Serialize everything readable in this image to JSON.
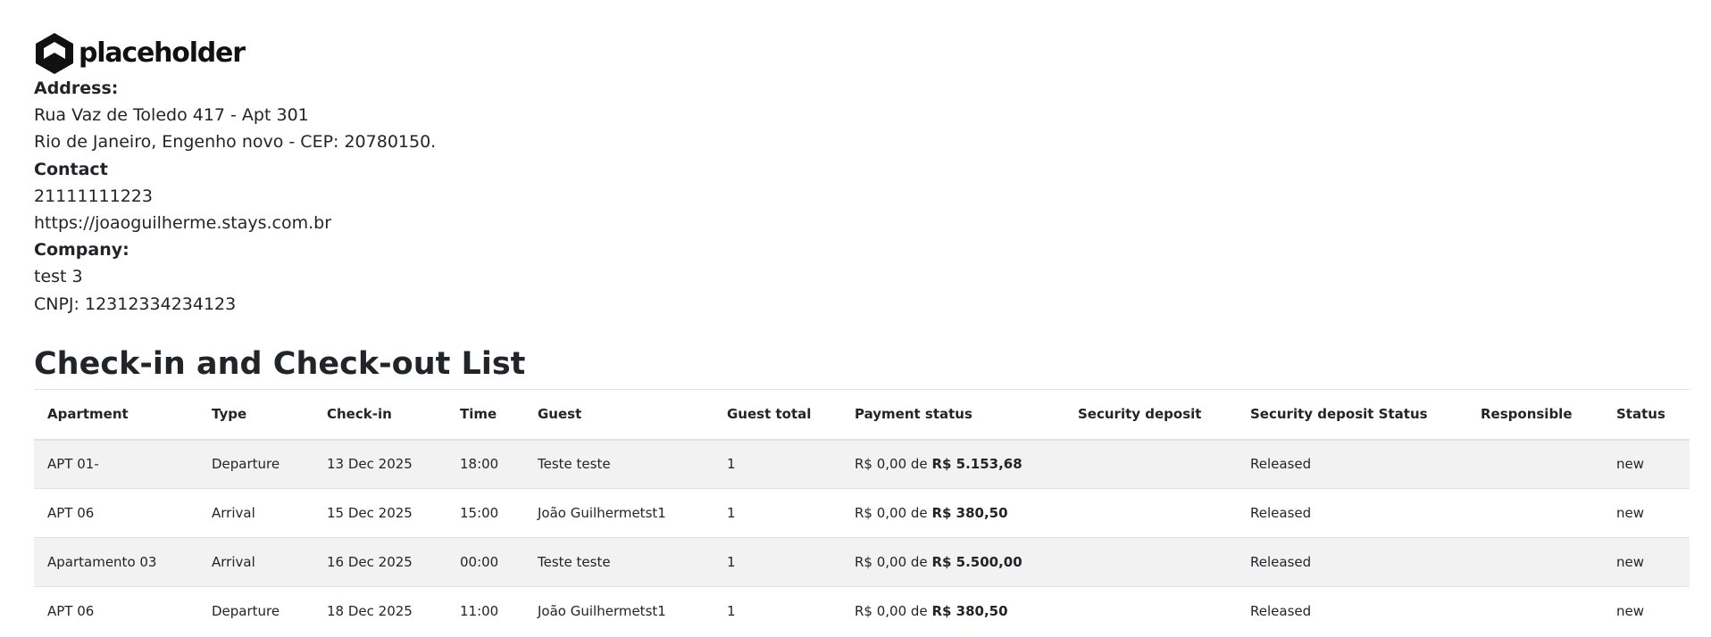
{
  "logo": {
    "text": "placeholder"
  },
  "info": {
    "address_label": "Address:",
    "address_line1": "Rua Vaz de Toledo 417 - Apt 301",
    "address_line2": "Rio de Janeiro, Engenho novo - CEP: 20780150.",
    "contact_label": "Contact",
    "phone": "21111111223",
    "website": "https://joaoguilherme.stays.com.br",
    "company_label": "Company:",
    "company_name": "test 3",
    "cnpj": "CNPJ: 12312334234123"
  },
  "title": "Check-in and Check-out List",
  "table": {
    "headers": {
      "apartment": "Apartment",
      "type": "Type",
      "checkin": "Check-in",
      "time": "Time",
      "guest": "Guest",
      "guest_total": "Guest total",
      "payment_status": "Payment status",
      "security_deposit": "Security deposit",
      "security_deposit_status": "Security deposit Status",
      "responsible": "Responsible",
      "status": "Status"
    },
    "rows": [
      {
        "apartment": "APT 01-",
        "type": "Departure",
        "checkin": "13 Dec 2025",
        "time": "18:00",
        "guest": "Teste teste",
        "guest_total": "1",
        "paid": "R$ 0,00 de",
        "total": "R$ 5.153,68",
        "security_deposit": "",
        "security_deposit_status": "Released",
        "responsible": "",
        "status": "new"
      },
      {
        "apartment": "APT 06",
        "type": "Arrival",
        "checkin": "15 Dec 2025",
        "time": "15:00",
        "guest": "João Guilhermetst1",
        "guest_total": "1",
        "paid": "R$ 0,00 de",
        "total": "R$ 380,50",
        "security_deposit": "",
        "security_deposit_status": "Released",
        "responsible": "",
        "status": "new"
      },
      {
        "apartment": "Apartamento 03",
        "type": "Arrival",
        "checkin": "16 Dec 2025",
        "time": "00:00",
        "guest": "Teste teste",
        "guest_total": "1",
        "paid": "R$ 0,00 de",
        "total": "R$ 5.500,00",
        "security_deposit": "",
        "security_deposit_status": "Released",
        "responsible": "",
        "status": "new"
      },
      {
        "apartment": "APT 06",
        "type": "Departure",
        "checkin": "18 Dec 2025",
        "time": "11:00",
        "guest": "João Guilhermetst1",
        "guest_total": "1",
        "paid": "R$ 0,00 de",
        "total": "R$ 380,50",
        "security_deposit": "",
        "security_deposit_status": "Released",
        "responsible": "",
        "status": "new"
      }
    ]
  }
}
